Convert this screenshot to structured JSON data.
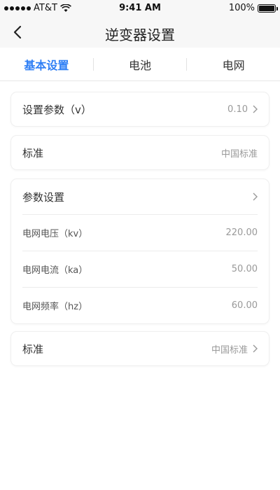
{
  "status_bar": {
    "carrier": "AT&T",
    "time": "9:41 AM",
    "battery": "100%"
  },
  "nav": {
    "title": "逆变器设置"
  },
  "tabs": [
    {
      "label": "基本设置",
      "active": true
    },
    {
      "label": "电池",
      "active": false
    },
    {
      "label": "电网",
      "active": false
    }
  ],
  "cards": {
    "set_param": {
      "label": "设置参数（v）",
      "value": "0.10"
    },
    "standard": {
      "label": "标准",
      "value": "中国标准"
    },
    "param_settings": {
      "label": "参数设置",
      "rows": [
        {
          "label": "电网电压（kv）",
          "value": "220.00"
        },
        {
          "label": "电网电流（ka）",
          "value": "50.00"
        },
        {
          "label": "电网频率（hz）",
          "value": "60.00"
        }
      ]
    },
    "standard2": {
      "label": "标准",
      "value": "中国标准"
    }
  },
  "colors": {
    "accent": "#2f7ff5",
    "background": "#ffffff",
    "header_bg": "#f7f7f7"
  }
}
